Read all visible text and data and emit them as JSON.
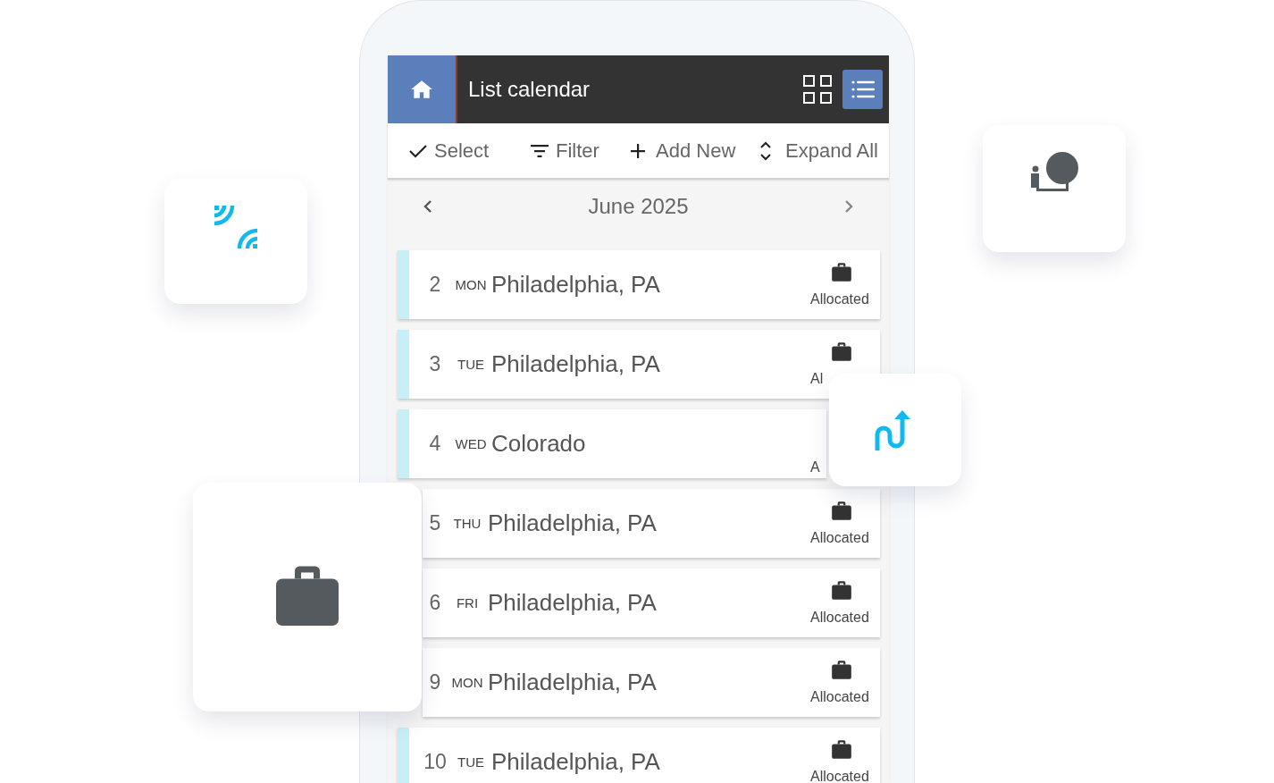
{
  "header": {
    "title": "List calendar",
    "views": [
      {
        "kind": "grid",
        "selected": false
      },
      {
        "kind": "list",
        "selected": true
      }
    ]
  },
  "toolbar": [
    {
      "kind": "check",
      "label": "Select"
    },
    {
      "kind": "filter",
      "label": "Filter"
    },
    {
      "kind": "plus",
      "label": "Add New"
    },
    {
      "kind": "expand",
      "label": "Expand All"
    }
  ],
  "month": {
    "label": "June 2025"
  },
  "rows": [
    {
      "day": "2",
      "weekday": "MON",
      "place": "Philadelphia, PA",
      "status": "Allocated"
    },
    {
      "day": "3",
      "weekday": "TUE",
      "place": "Philadelphia, PA",
      "status": "Al"
    },
    {
      "day": "4",
      "weekday": "WED",
      "place": "Colorado",
      "status": "A"
    },
    {
      "day": "5",
      "weekday": "THU",
      "place": "Philadelphia, PA",
      "status": "Allocated"
    },
    {
      "day": "6",
      "weekday": "FRI",
      "place": "Philadelphia, PA",
      "status": "Allocated"
    },
    {
      "day": "9",
      "weekday": "MON",
      "place": "Philadelphia, PA",
      "status": "Allocated"
    },
    {
      "day": "10",
      "weekday": "TUE",
      "place": "Philadelphia, PA",
      "status": "Allocated"
    }
  ],
  "floating_cards": [
    {
      "kind": "signal"
    },
    {
      "kind": "park"
    },
    {
      "kind": "route"
    },
    {
      "kind": "briefcase"
    }
  ]
}
